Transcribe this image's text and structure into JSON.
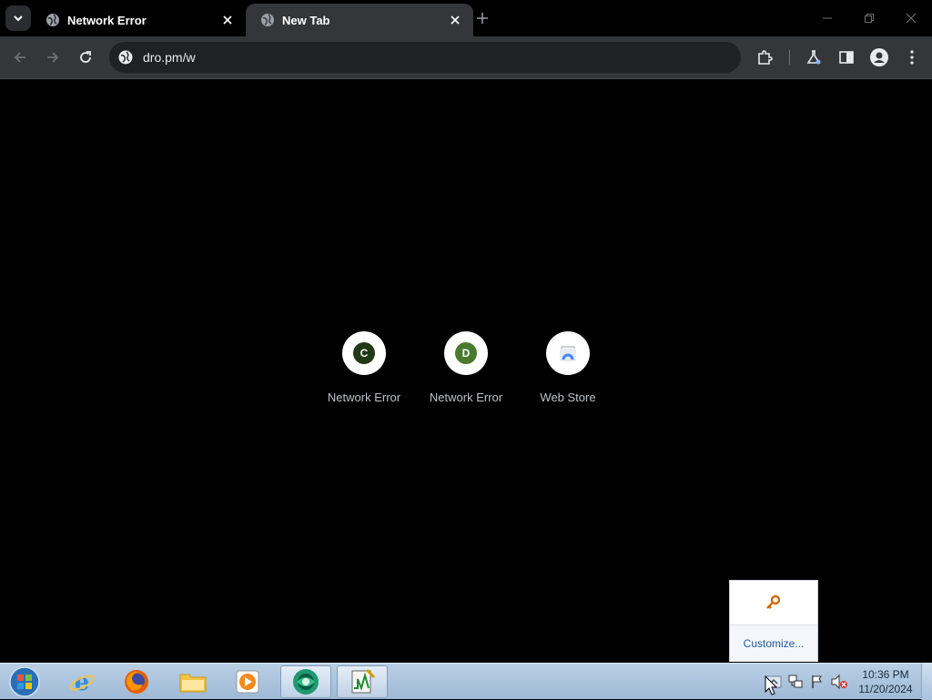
{
  "browser": {
    "tabs": [
      {
        "title": "Network Error",
        "active": false
      },
      {
        "title": "New Tab",
        "active": true
      }
    ],
    "address": "dro.pm/w"
  },
  "shortcuts": [
    {
      "letter": "C",
      "label": "Network Error",
      "color": "#1f3a14"
    },
    {
      "letter": "D",
      "label": "Network Error",
      "color": "#4a7a2e"
    },
    {
      "letter": "",
      "label": "Web Store",
      "color": "#4285f4"
    }
  ],
  "tray_popup": {
    "customize": "Customize..."
  },
  "taskbar": {
    "apps": [
      "internet-explorer",
      "firefox",
      "file-explorer",
      "media-player",
      "chrome-green",
      "activity-monitor"
    ],
    "clock": {
      "time": "10:36 PM",
      "date": "11/20/2024"
    }
  }
}
